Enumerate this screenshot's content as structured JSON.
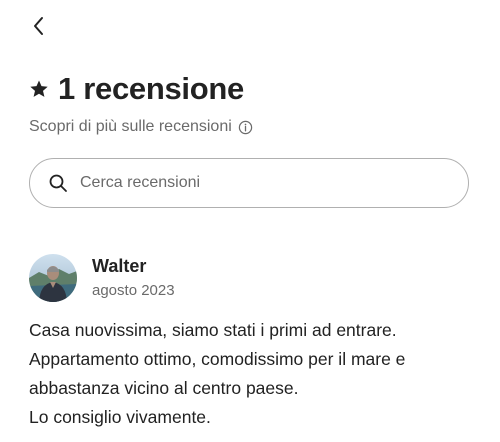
{
  "header": {
    "back_icon": "chevron-left-icon"
  },
  "title": {
    "icon": "star-icon",
    "text": "1 recensione"
  },
  "learn_more": {
    "label": "Scopri di più sulle recensioni",
    "icon": "info-icon"
  },
  "search": {
    "icon": "search-icon",
    "placeholder": "Cerca recensioni",
    "value": ""
  },
  "reviews": [
    {
      "author": "Walter",
      "date": "agosto 2023",
      "avatar": "avatar-photo",
      "text_lines": [
        "Casa nuovissima, siamo stati i primi ad entrare.",
        "Appartamento ottimo, comodissimo per il mare e",
        "abbastanza vicino al centro paese.",
        "Lo consiglio vivamente."
      ]
    }
  ],
  "colors": {
    "text_primary": "#222222",
    "text_secondary": "#6a6a6a",
    "border": "#b0b0b0",
    "background": "#ffffff"
  }
}
